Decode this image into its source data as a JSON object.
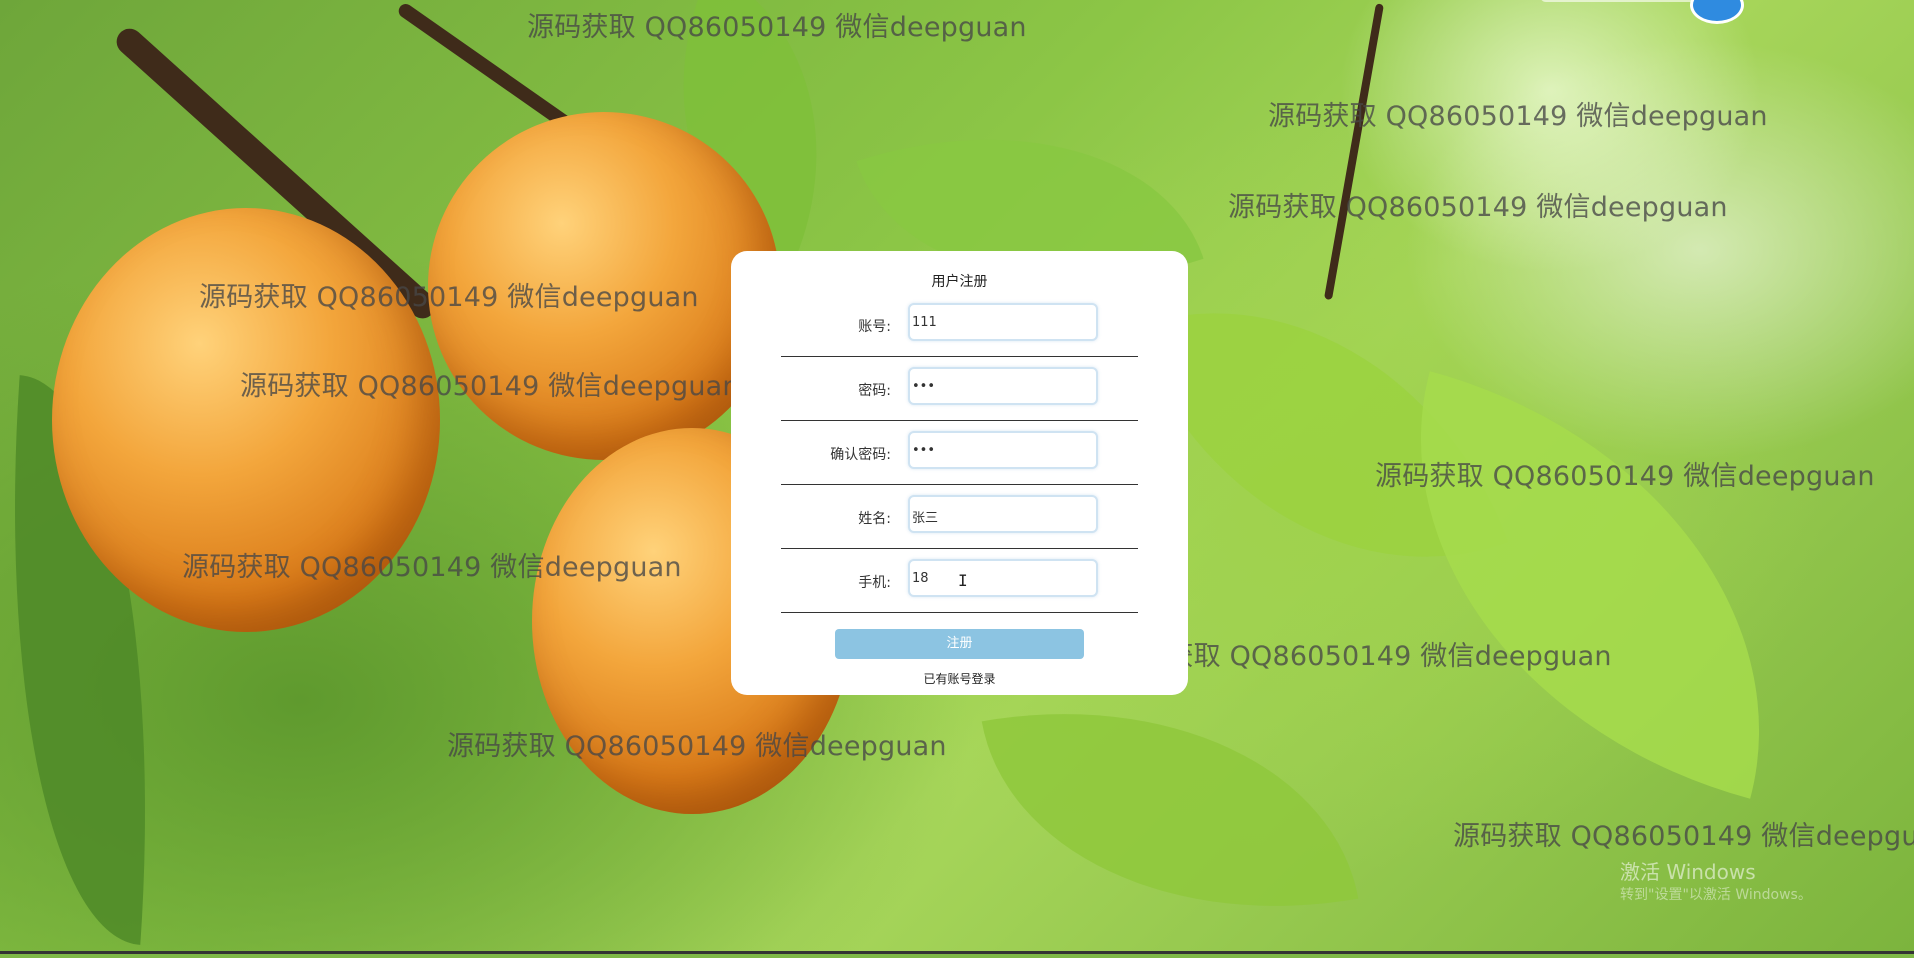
{
  "form": {
    "title": "用户注册",
    "fields": [
      {
        "label": "账号:",
        "value": "111"
      },
      {
        "label": "密码:",
        "value": "•••"
      },
      {
        "label": "确认密码:",
        "value": "•••"
      },
      {
        "label": "姓名:",
        "value": "张三"
      },
      {
        "label": "手机:",
        "value": "18"
      }
    ],
    "submit_label": "注册",
    "login_link": "已有账号登录"
  },
  "watermark_text": "源码获取 QQ86050149 微信deepguan",
  "windows_activation": {
    "line1": "激活 Windows",
    "line2": "转到\"设置\"以激活 Windows。"
  },
  "colors": {
    "submit_button": "#8cc4e2",
    "input_border": "#cfe3f2",
    "card_background": "#ffffff"
  }
}
